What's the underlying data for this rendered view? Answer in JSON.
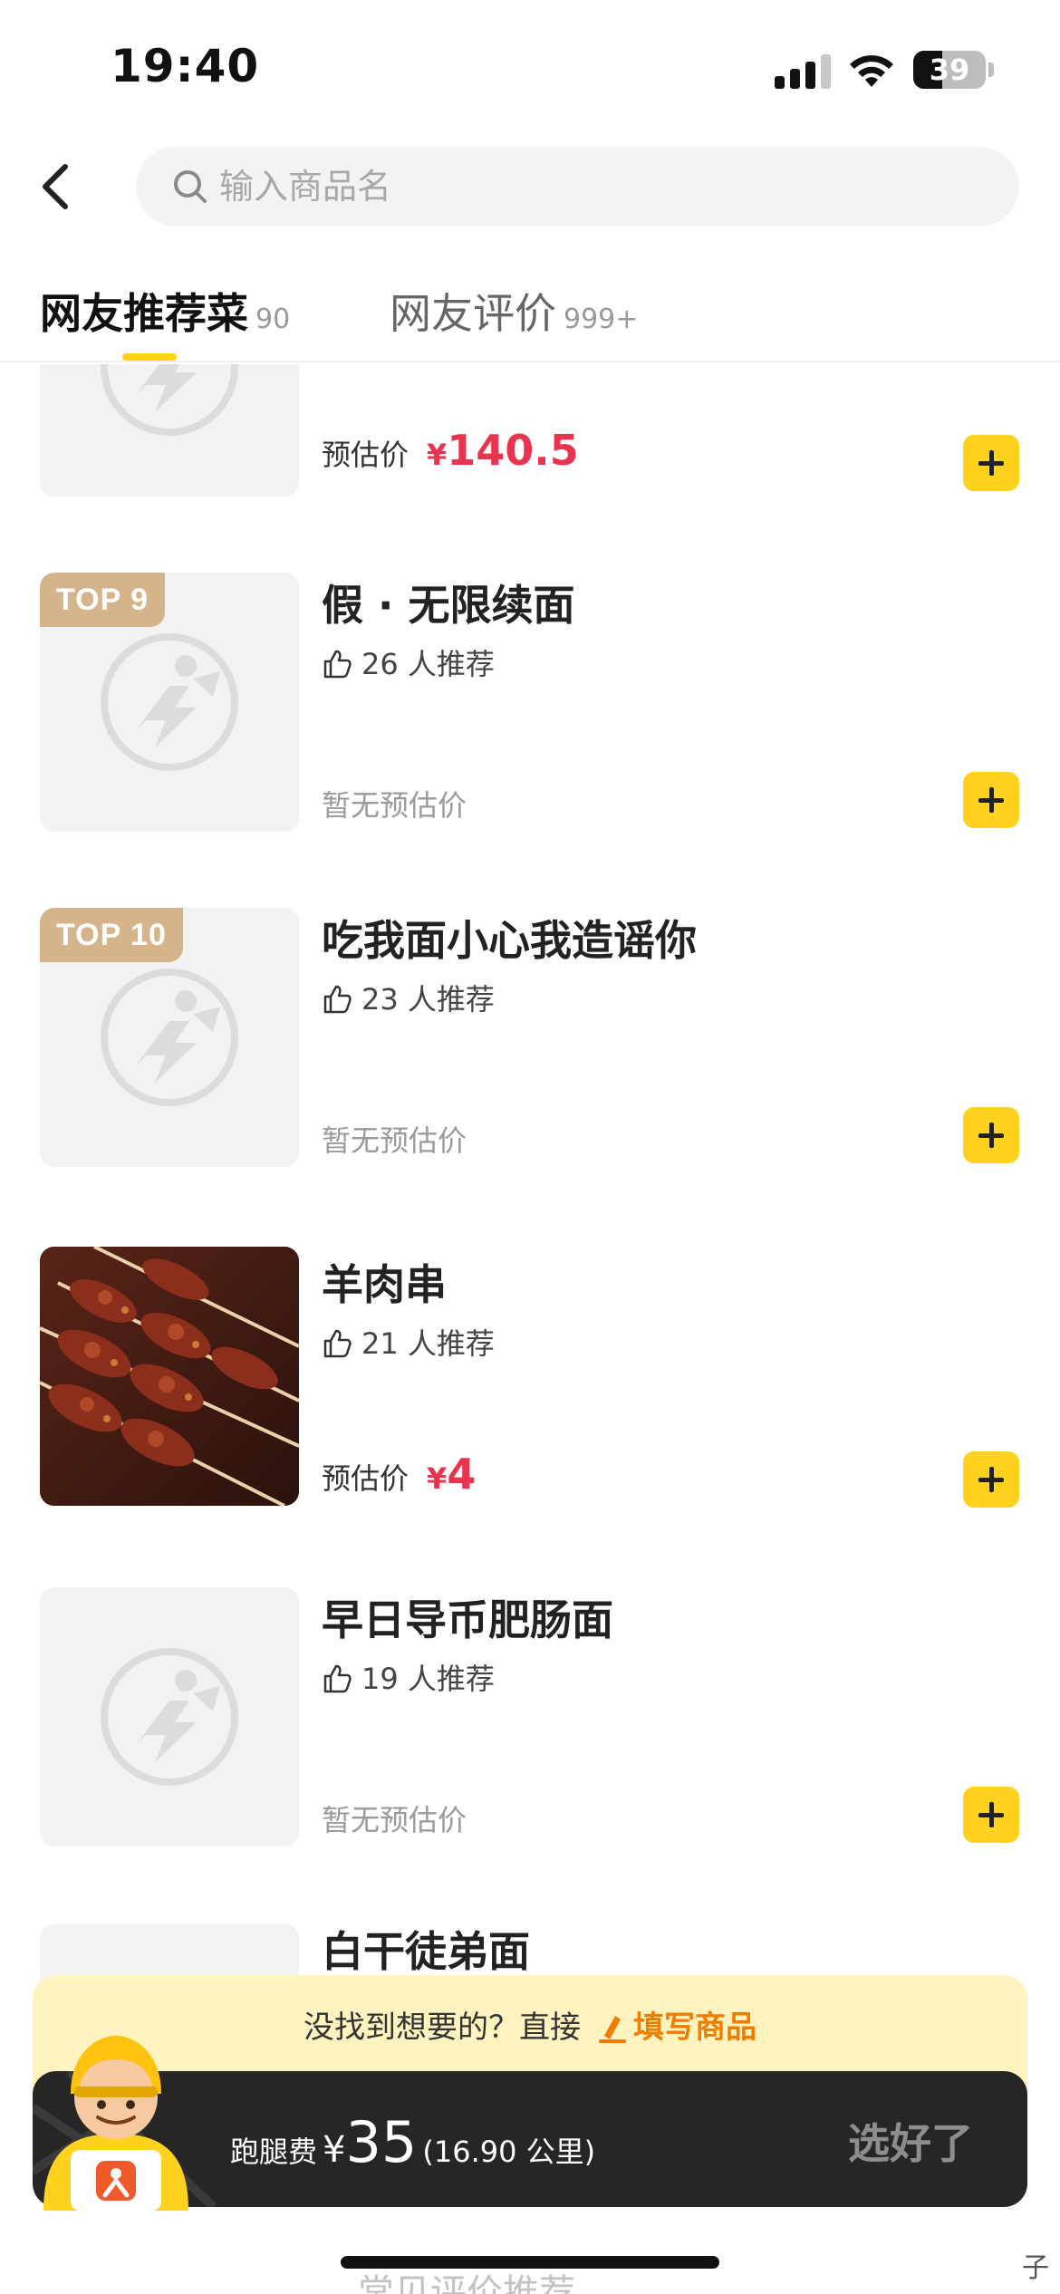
{
  "status_bar": {
    "time": "19:40",
    "battery": "39"
  },
  "search": {
    "placeholder": "输入商品名"
  },
  "tabs": [
    {
      "label": "网友推荐菜",
      "count": "90"
    },
    {
      "label": "网友评价",
      "count": "999+"
    }
  ],
  "items": [
    {
      "name": "",
      "badge": "",
      "recommend": "",
      "price_label": "预估价",
      "currency": "¥",
      "price": "140.5"
    },
    {
      "name": "假 · 无限续面",
      "badge": "TOP 9",
      "recommend": "26 人推荐",
      "no_price": "暂无预估价"
    },
    {
      "name": "吃我面小心我造谣你",
      "badge": "TOP 10",
      "recommend": "23 人推荐",
      "no_price": "暂无预估价"
    },
    {
      "name": "羊肉串",
      "badge": "",
      "recommend": "21 人推荐",
      "price_label": "预估价",
      "currency": "¥",
      "price": "4"
    },
    {
      "name": "早日导币肥肠面",
      "badge": "",
      "recommend": "19 人推荐",
      "no_price": "暂无预估价"
    },
    {
      "name": "白干徒弟面",
      "badge": "",
      "recommend": ""
    }
  ],
  "banner": {
    "hint": "没找到想要的？直接",
    "link": "填写商品"
  },
  "checkout": {
    "fee_label": "跑腿费",
    "currency": "¥",
    "amount": "35",
    "distance": "(16.90 公里)",
    "done_label": "选好了"
  },
  "underlay": {
    "text": "…常见评价推荐…",
    "right_char": "子"
  },
  "colors": {
    "accent": "#ffd21e",
    "price": "#e8344f",
    "link": "#f07d00",
    "badge": "#d5b48c"
  }
}
